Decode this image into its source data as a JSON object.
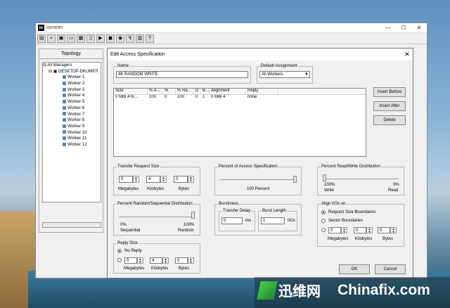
{
  "window": {
    "title": "Iometer",
    "logo": "Io",
    "controls": [
      "—",
      "☐",
      "✕"
    ]
  },
  "toolbar": {
    "icons": [
      "open-icon",
      "save-icon",
      "new-manager-icon",
      "new-worker-icon",
      "tree-icon",
      "copy-icon",
      "start-icon",
      "stop-icon",
      "stop-all-icon",
      "reset-icon",
      "exit-icon",
      "help-icon"
    ],
    "glyphs": [
      "▤",
      "▪",
      "▣",
      "▭",
      "▦",
      "▯",
      "▶",
      "◼",
      "◉",
      "↯",
      "▥",
      "?"
    ]
  },
  "topology": {
    "header": "Topology",
    "root": "All Managers",
    "manager": "DESKTOP-DKUM97I",
    "workers": [
      "Worker 1",
      "Worker 2",
      "Worker 3",
      "Worker 4",
      "Worker 5",
      "Worker 6",
      "Worker 7",
      "Worker 8",
      "Worker 9",
      "Worker 10",
      "Worker 11",
      "Worker 12"
    ]
  },
  "dialog": {
    "title": "Edit Access Specification",
    "close": "✕",
    "name_label": "Name",
    "name_value": "4K RANDOM WRITE",
    "default_assignment_label": "Default Assignment",
    "default_assignment_value": "All Workers",
    "table": {
      "headers": [
        "Size",
        "% A...",
        "%",
        "% Ra...",
        "D",
        "B...",
        "Alignment",
        "Reply"
      ],
      "rows": [
        [
          "0 MiB  4 Ki...",
          "100",
          "0",
          "100",
          "0",
          "1",
          "0 MiB  4",
          "none"
        ]
      ]
    },
    "buttons": {
      "insert_before": "Insert Before",
      "insert_after": "Insert After",
      "delete": "Delete",
      "ok": "OK",
      "cancel": "Cancel"
    },
    "transfer": {
      "label": "Transfer Request Size",
      "mb": "0",
      "kb": "4",
      "b": "0",
      "mb_label": "Megabytes",
      "kb_label": "Kilobytes",
      "b_label": "Bytes"
    },
    "percent_access": {
      "label": "Percent of Access Specification",
      "value": "100 Percent"
    },
    "rw": {
      "label": "Percent Read/Write Distribution",
      "left_pct": "100%",
      "right_pct": "0%",
      "left": "Write",
      "right": "Read",
      "read_fraction": 0
    },
    "random": {
      "label": "Percent Random/Sequential Distribution",
      "left_pct": "0%",
      "right_pct": "100%",
      "left": "Sequential",
      "right": "Random",
      "random_fraction": 1
    },
    "burst": {
      "label": "Burstiness",
      "delay_label": "Transfer Delay",
      "delay_value": "0",
      "delay_unit": "ms",
      "length_label": "Burst Length",
      "length_value": "1",
      "length_unit": "I/Os"
    },
    "align": {
      "label": "Align I/Os on",
      "opt1": "Request Size Boundaries",
      "opt2": "Sector Boundaries",
      "mb": "0",
      "kb": "0",
      "b": "0",
      "mb_label": "Megabytes",
      "kb_label": "Kilobytes",
      "b_label": "Bytes"
    },
    "reply": {
      "label": "Reply Size",
      "opt1": "No Reply",
      "mb": "0",
      "kb": "4",
      "b": "0",
      "mb_label": "Megabytes",
      "kb_label": "Kilobytes",
      "b_label": "Bytes"
    }
  },
  "watermark": {
    "cn": "迅维网",
    "en": "Chinafix.com"
  }
}
